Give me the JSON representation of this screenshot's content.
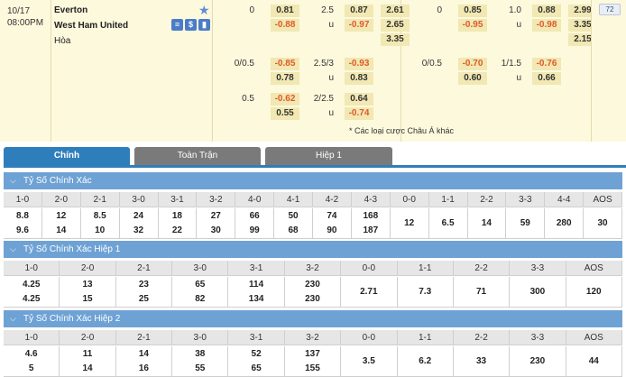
{
  "match": {
    "date": "10/17",
    "time": "08:00PM",
    "home": "Everton",
    "away": "West Ham United",
    "draw": "Hòa",
    "icons": [
      "list-icon",
      "money-icon",
      "chart-icon"
    ],
    "badge": "72"
  },
  "ft_rows": [
    {
      "hcap": "0",
      "h1": "0.81",
      "h2": "-0.88",
      "ou": "2.5",
      "ou1": "0.87",
      "ou_u": "u",
      "ou2": "-0.97",
      "x1": "2.61",
      "x2": "2.65",
      "x3": "3.35"
    },
    {
      "hcap": "0/0.5",
      "h1": "-0.85",
      "h2": "0.78",
      "ou": "2.5/3",
      "ou1": "-0.93",
      "ou_u": "u",
      "ou2": "0.83"
    },
    {
      "hcap": "0.5",
      "h1": "-0.62",
      "h2": "0.55",
      "ou": "2/2.5",
      "ou1": "0.64",
      "ou_u": "u",
      "ou2": "-0.74"
    }
  ],
  "ht_rows": [
    {
      "hcap": "0",
      "h1": "0.85",
      "h2": "-0.95",
      "ou": "1.0",
      "ou1": "0.88",
      "ou_u": "u",
      "ou2": "-0.98",
      "x1": "2.99",
      "x2": "3.35",
      "x3": "2.15"
    },
    {
      "hcap": "0/0.5",
      "h1": "-0.70",
      "h2": "0.60",
      "ou": "1/1.5",
      "ou1": "-0.76",
      "ou_u": "u",
      "ou2": "0.66"
    }
  ],
  "more_link": "* Các loại cược Châu Á khác",
  "tabs": [
    "Chính",
    "Toàn Trận",
    "Hiệp 1"
  ],
  "sections": [
    {
      "title": "Tỷ Số Chính Xác",
      "headers": [
        "1-0",
        "2-0",
        "2-1",
        "3-0",
        "3-1",
        "3-2",
        "4-0",
        "4-1",
        "4-2",
        "4-3",
        "0-0",
        "1-1",
        "2-2",
        "3-3",
        "4-4",
        "AOS"
      ],
      "cells": [
        [
          "8.8",
          "9.6"
        ],
        [
          "12",
          "14"
        ],
        [
          "8.5",
          "10"
        ],
        [
          "24",
          "32"
        ],
        [
          "18",
          "22"
        ],
        [
          "27",
          "30"
        ],
        [
          "66",
          "99"
        ],
        [
          "50",
          "68"
        ],
        [
          "74",
          "90"
        ],
        [
          "168",
          "187"
        ],
        [
          "12"
        ],
        [
          "6.5"
        ],
        [
          "14"
        ],
        [
          "59"
        ],
        [
          "280"
        ],
        [
          "30"
        ]
      ]
    },
    {
      "title": "Tỷ Số Chính Xác Hiệp 1",
      "headers": [
        "1-0",
        "2-0",
        "2-1",
        "3-0",
        "3-1",
        "3-2",
        "0-0",
        "1-1",
        "2-2",
        "3-3",
        "AOS"
      ],
      "cells": [
        [
          "4.25",
          "4.25"
        ],
        [
          "13",
          "15"
        ],
        [
          "23",
          "25"
        ],
        [
          "65",
          "82"
        ],
        [
          "114",
          "134"
        ],
        [
          "230",
          "230"
        ],
        [
          "2.71"
        ],
        [
          "7.3"
        ],
        [
          "71"
        ],
        [
          "300"
        ],
        [
          "120"
        ]
      ]
    },
    {
      "title": "Tỷ Số Chính Xác Hiệp 2",
      "headers": [
        "1-0",
        "2-0",
        "2-1",
        "3-0",
        "3-1",
        "3-2",
        "0-0",
        "1-1",
        "2-2",
        "3-3",
        "AOS"
      ],
      "cells": [
        [
          "4.6",
          "5"
        ],
        [
          "11",
          "14"
        ],
        [
          "14",
          "16"
        ],
        [
          "38",
          "55"
        ],
        [
          "52",
          "65"
        ],
        [
          "137",
          "155"
        ],
        [
          "3.5"
        ],
        [
          "6.2"
        ],
        [
          "33"
        ],
        [
          "230"
        ],
        [
          "44"
        ]
      ]
    }
  ]
}
